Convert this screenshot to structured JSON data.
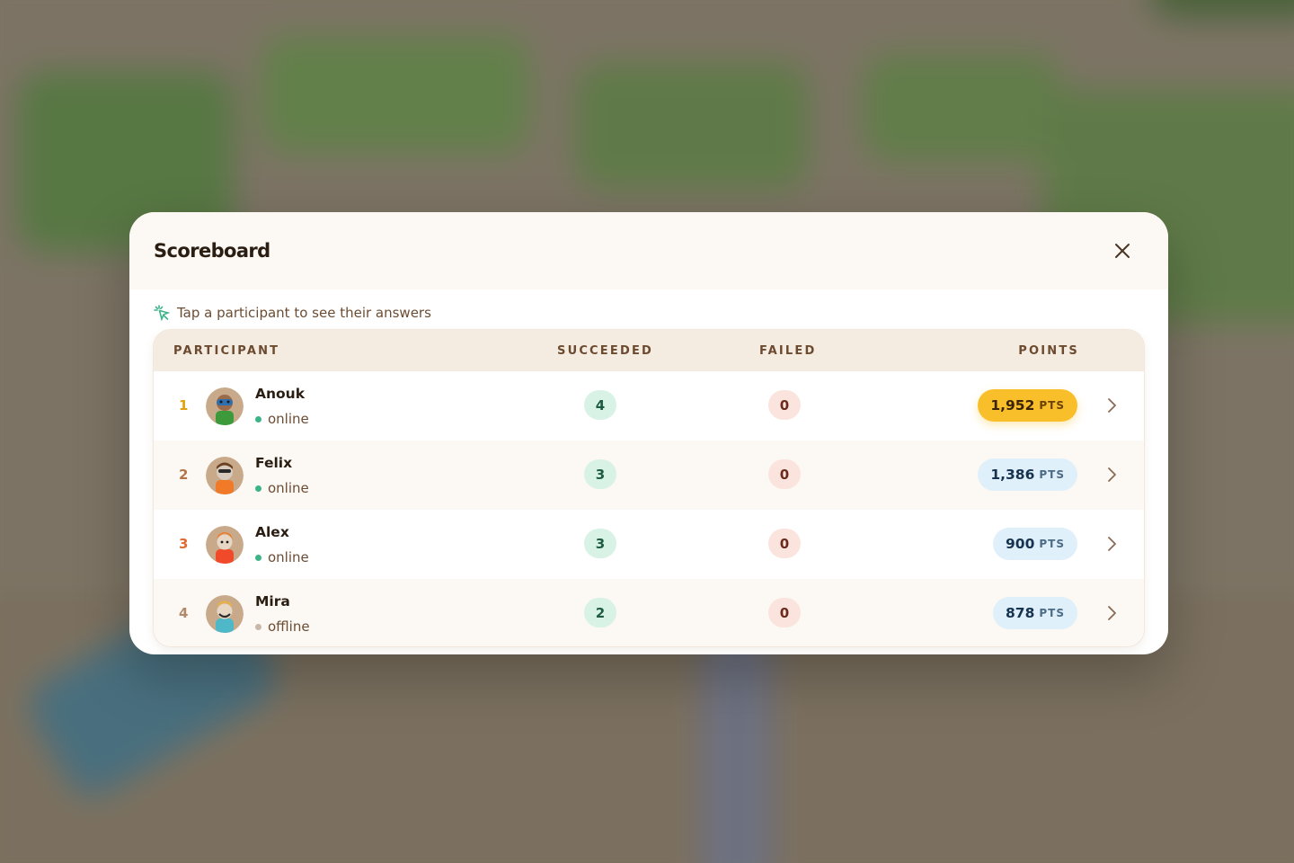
{
  "modal": {
    "title": "Scoreboard",
    "hint": "Tap a participant to see their answers"
  },
  "table": {
    "headers": {
      "participant": "PARTICIPANT",
      "succeeded": "SUCCEEDED",
      "failed": "FAILED",
      "points": "POINTS"
    },
    "rows": [
      {
        "rank": "1",
        "name": "Anouk",
        "status": "online",
        "succeeded": "4",
        "failed": "0",
        "points": "1,952",
        "unit": "PTS"
      },
      {
        "rank": "2",
        "name": "Felix",
        "status": "online",
        "succeeded": "3",
        "failed": "0",
        "points": "1,386",
        "unit": "PTS"
      },
      {
        "rank": "3",
        "name": "Alex",
        "status": "online",
        "succeeded": "3",
        "failed": "0",
        "points": "900",
        "unit": "PTS"
      },
      {
        "rank": "4",
        "name": "Mira",
        "status": "offline",
        "succeeded": "2",
        "failed": "0",
        "points": "878",
        "unit": "PTS"
      }
    ]
  },
  "colors": {
    "rank_1": "#e0a20c",
    "rank_2": "#b57348",
    "rank_3": "#e06a32",
    "rank_4": "#b08a6a",
    "online": "#3bb488",
    "offline": "#c9b8a8",
    "gold_pill": "#f8bf2a",
    "blue_pill": "#e0f0fb"
  },
  "icons": {
    "close": "close-icon",
    "hint": "sparkle-tap-icon",
    "row_action": "chevron-right-icon"
  }
}
